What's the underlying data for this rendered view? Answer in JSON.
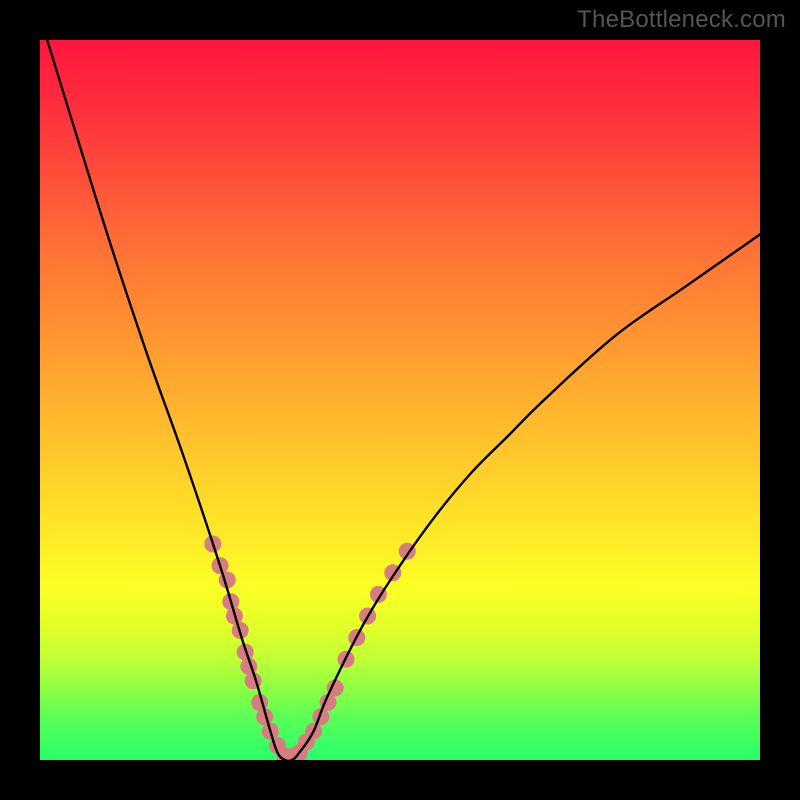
{
  "watermark": "TheBottleneck.com",
  "chart_data": {
    "type": "line",
    "title": "",
    "xlabel": "",
    "ylabel": "",
    "xlim": [
      0,
      100
    ],
    "ylim": [
      0,
      100
    ],
    "grid": false,
    "legend": false,
    "series": [
      {
        "name": "bottleneck-curve",
        "x": [
          1,
          5,
          10,
          15,
          20,
          25,
          28,
          30,
          32,
          33,
          34,
          35,
          36,
          38,
          40,
          45,
          50,
          55,
          60,
          65,
          70,
          80,
          90,
          100
        ],
        "y": [
          100,
          87,
          71,
          56,
          42,
          27,
          17,
          11,
          4,
          1,
          0,
          0,
          1,
          4,
          9,
          19,
          27,
          34,
          40,
          45,
          50,
          59,
          66,
          73
        ],
        "color": "#000000"
      }
    ],
    "markers": {
      "name": "highlighted-points",
      "color": "#d77c81",
      "points": [
        {
          "x": 24,
          "y": 30
        },
        {
          "x": 25,
          "y": 27
        },
        {
          "x": 26,
          "y": 25
        },
        {
          "x": 26.5,
          "y": 22
        },
        {
          "x": 27,
          "y": 20
        },
        {
          "x": 27.8,
          "y": 18
        },
        {
          "x": 28.5,
          "y": 15
        },
        {
          "x": 29,
          "y": 13
        },
        {
          "x": 29.6,
          "y": 11
        },
        {
          "x": 30.5,
          "y": 8
        },
        {
          "x": 31.2,
          "y": 6
        },
        {
          "x": 32,
          "y": 4
        },
        {
          "x": 33,
          "y": 2
        },
        {
          "x": 34,
          "y": 0.5
        },
        {
          "x": 35,
          "y": 0.5
        },
        {
          "x": 36,
          "y": 1
        },
        {
          "x": 37,
          "y": 2.5
        },
        {
          "x": 38,
          "y": 4
        },
        {
          "x": 39,
          "y": 6
        },
        {
          "x": 40,
          "y": 8
        },
        {
          "x": 41,
          "y": 10
        },
        {
          "x": 42.5,
          "y": 14
        },
        {
          "x": 44,
          "y": 17
        },
        {
          "x": 45.5,
          "y": 20
        },
        {
          "x": 47,
          "y": 23
        },
        {
          "x": 49,
          "y": 26
        },
        {
          "x": 51,
          "y": 29
        }
      ]
    },
    "background_gradient": {
      "orientation": "vertical",
      "stops": [
        {
          "pos": 0.0,
          "color": "#ff163f"
        },
        {
          "pos": 0.5,
          "color": "#ffaa2f"
        },
        {
          "pos": 0.76,
          "color": "#fbff25"
        },
        {
          "pos": 1.0,
          "color": "#27ff6c"
        }
      ]
    }
  }
}
